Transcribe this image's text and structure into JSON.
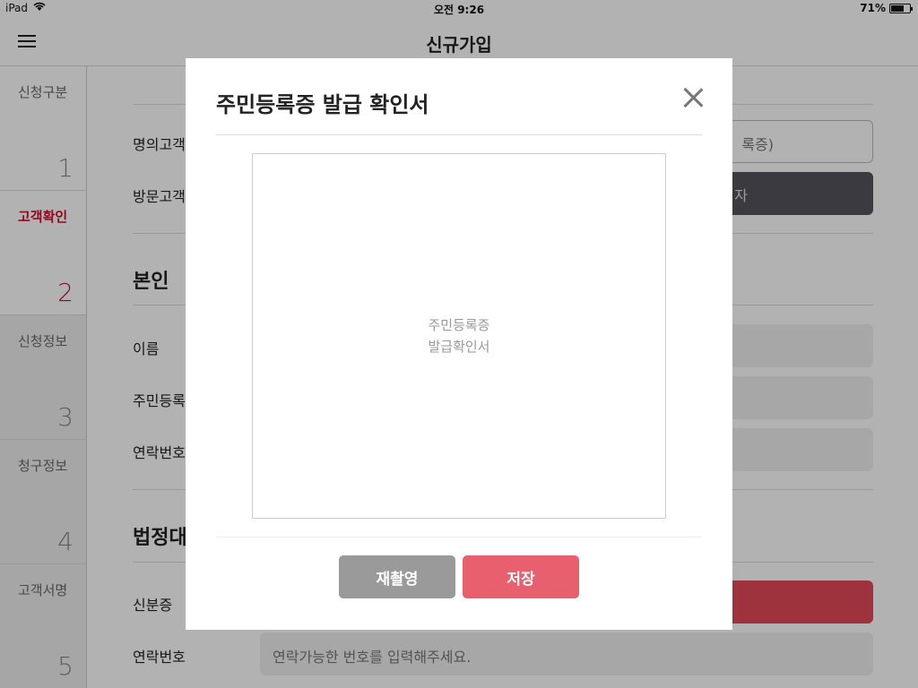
{
  "status_bar": {
    "device": "iPad",
    "time": "오전 9:26",
    "battery_percent": "71%",
    "battery_level": 0.71
  },
  "nav": {
    "title": "신규가입"
  },
  "sidebar": {
    "steps": [
      {
        "label": "신청구분",
        "num": "1"
      },
      {
        "label": "고객확인",
        "num": "2",
        "active": true
      },
      {
        "label": "신청정보",
        "num": "3"
      },
      {
        "label": "청구정보",
        "num": "4"
      },
      {
        "label": "고객서명",
        "num": "5"
      }
    ]
  },
  "main": {
    "rows": {
      "owner": "명의고객",
      "visitor": "방문고객",
      "name": "이름",
      "resident": "주민등록",
      "phone": "연락번호",
      "id_card": "신분증",
      "contact": "연락번호"
    },
    "sections": {
      "self": "본인",
      "legal": "법정대"
    },
    "fields": {
      "owner_value": "록증)",
      "visitor_value": "자",
      "contact_placeholder": "연락가능한 번호를 입력해주세요."
    }
  },
  "modal": {
    "title": "주민등록증 발급 확인서",
    "preview_line1": "주민등록증",
    "preview_line2": "발급확인서",
    "retake_label": "재촬영",
    "save_label": "저장"
  },
  "colors": {
    "accent": "#c8102e",
    "save_button": "#e8606d",
    "retake_button": "#9a9a9a",
    "dark_button": "#55545e"
  }
}
